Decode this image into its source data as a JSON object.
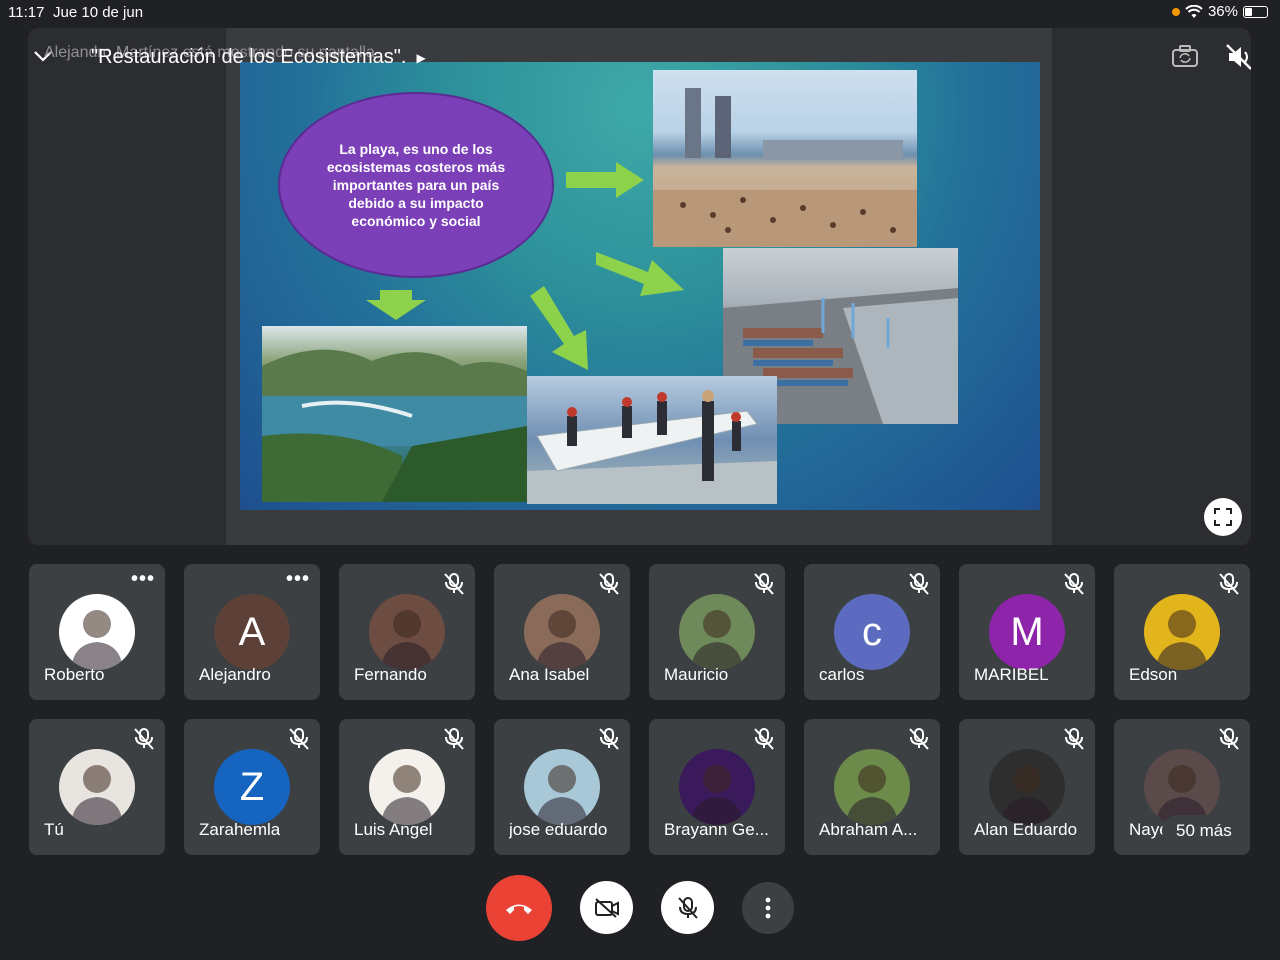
{
  "status": {
    "time": "11:17",
    "date": "Jue 10 de jun",
    "battery": "36%"
  },
  "presentation": {
    "presenter_notice": "Alejandro Martínez está mostrando su pantalla",
    "title": "\"Restauración de los Ecosistemas\".",
    "slide_text": "La playa, es uno de los ecosistemas costeros más importantes para un país debido a su impacto económico y social"
  },
  "participants": [
    {
      "name": "Roberto",
      "avatar": "photo",
      "color": "#ffffff",
      "status": "menu"
    },
    {
      "name": "Alejandro",
      "avatar_letter": "A",
      "color": "#5d4037",
      "status": "menu"
    },
    {
      "name": "Fernando",
      "avatar": "photo",
      "color": "#6d4c41",
      "status": "muted"
    },
    {
      "name": "Ana Isabel",
      "avatar": "photo",
      "color": "#8a6b5a",
      "status": "muted"
    },
    {
      "name": "Mauricio",
      "avatar": "photo",
      "color": "#6f8a5a",
      "status": "muted"
    },
    {
      "name": "carlos",
      "avatar_letter": "c",
      "color": "#5c6bc0",
      "status": "muted"
    },
    {
      "name": "MARIBEL",
      "avatar_letter": "M",
      "color": "#8e24aa",
      "status": "muted"
    },
    {
      "name": "Edson",
      "avatar": "photo",
      "color": "#e3b51c",
      "status": "muted"
    },
    {
      "name": "Tú",
      "avatar": "photo",
      "color": "#e8e4e0",
      "status": "muted"
    },
    {
      "name": "Zarahemla",
      "avatar_letter": "Z",
      "color": "#1565c0",
      "status": "muted"
    },
    {
      "name": "Luis Angel",
      "avatar": "photo",
      "color": "#f4f1ec",
      "status": "muted"
    },
    {
      "name": "jose eduardo",
      "avatar": "photo",
      "color": "#a8c8d8",
      "status": "muted"
    },
    {
      "name": "Brayann Ge...",
      "avatar": "photo",
      "color": "#3a1a5a",
      "status": "muted"
    },
    {
      "name": "Abraham A...",
      "avatar": "photo",
      "color": "#6c8a4a",
      "status": "muted"
    },
    {
      "name": "Alan Eduardo",
      "avatar": "photo",
      "color": "#2e2e2e",
      "status": "muted"
    },
    {
      "name": "Nayeli",
      "avatar": "photo",
      "color": "#5a4a4a",
      "status": "muted"
    }
  ],
  "more_label": "50 más",
  "controls": {
    "end_call_color": "#ea4335"
  }
}
